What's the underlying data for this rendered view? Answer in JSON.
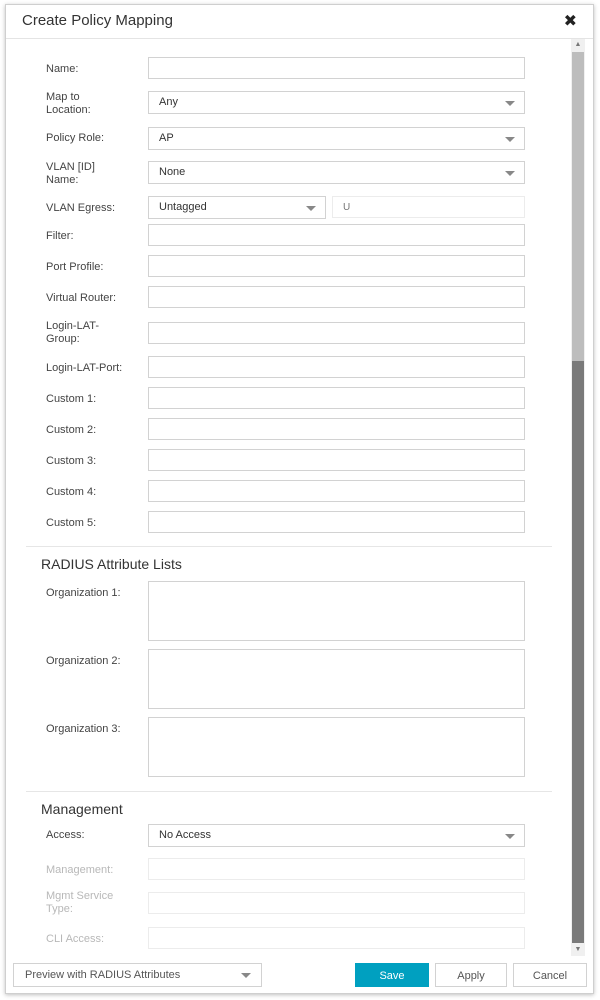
{
  "dialog": {
    "title": "Create Policy Mapping",
    "close_icon": "close-icon"
  },
  "form": {
    "name": {
      "label": "Name:",
      "value": ""
    },
    "map_to_location": {
      "label": "Map to Location:",
      "value": "Any"
    },
    "policy_role": {
      "label": "Policy Role:",
      "value": "AP"
    },
    "vlan_name": {
      "label": "VLAN [ID] Name:",
      "value": "None"
    },
    "vlan_egress": {
      "label": "VLAN Egress:",
      "value": "Untagged",
      "code_placeholder": "U"
    },
    "filter": {
      "label": "Filter:",
      "value": ""
    },
    "port_profile": {
      "label": "Port Profile:",
      "value": ""
    },
    "virtual_router": {
      "label": "Virtual Router:",
      "value": ""
    },
    "login_lat_group": {
      "label": "Login-LAT-Group:",
      "value": ""
    },
    "login_lat_port": {
      "label": "Login-LAT-Port:",
      "value": ""
    },
    "custom": [
      {
        "label": "Custom 1:",
        "value": ""
      },
      {
        "label": "Custom 2:",
        "value": ""
      },
      {
        "label": "Custom 3:",
        "value": ""
      },
      {
        "label": "Custom 4:",
        "value": ""
      },
      {
        "label": "Custom 5:",
        "value": ""
      }
    ]
  },
  "radius": {
    "title": "RADIUS Attribute Lists",
    "organizations": [
      {
        "label": "Organization 1:",
        "value": ""
      },
      {
        "label": "Organization 2:",
        "value": ""
      },
      {
        "label": "Organization 3:",
        "value": ""
      }
    ]
  },
  "management": {
    "title": "Management",
    "access": {
      "label": "Access:",
      "value": "No Access"
    },
    "management": {
      "label": "Management:",
      "value": ""
    },
    "mgmt_service_type": {
      "label": "Mgmt Service Type:",
      "value": ""
    },
    "cli_access": {
      "label": "CLI Access:",
      "value": ""
    }
  },
  "footer": {
    "preview_label": "Preview with RADIUS Attributes",
    "save_label": "Save",
    "apply_label": "Apply",
    "cancel_label": "Cancel"
  },
  "colors": {
    "primary": "#00a0c0",
    "scroll_thumb": "#7a7a7a"
  }
}
